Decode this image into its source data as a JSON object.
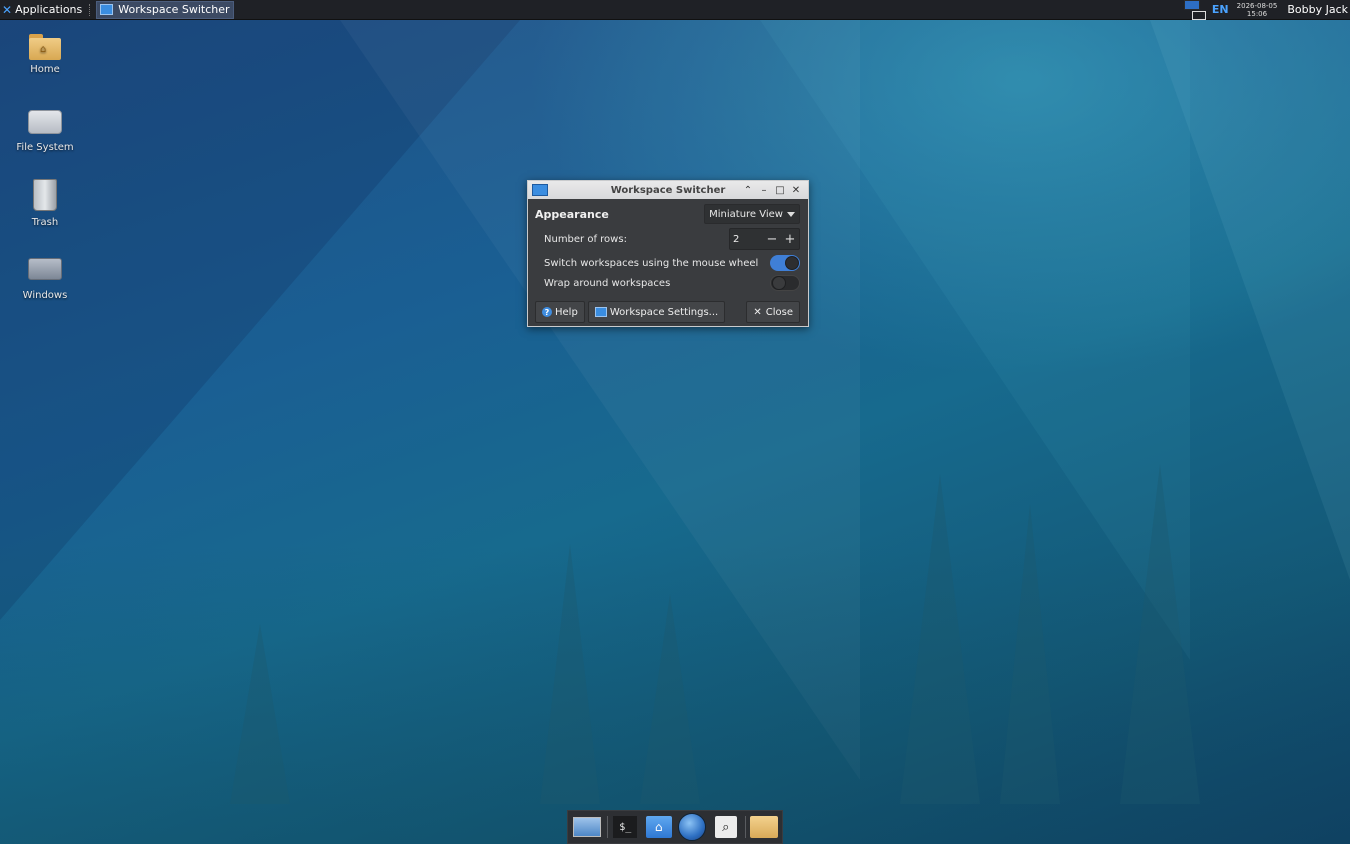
{
  "top_panel": {
    "apps_label": "Applications",
    "active_task": "Workspace Switcher",
    "lang": "EN",
    "date": "2026-08-05",
    "time": "15:06",
    "user": "Bobby Jack"
  },
  "desktop": {
    "icons": [
      {
        "label": "Home"
      },
      {
        "label": "File System"
      },
      {
        "label": "Trash"
      },
      {
        "label": "Windows"
      }
    ]
  },
  "dialog": {
    "title": "Workspace Switcher",
    "section": "Appearance",
    "view_mode": "Miniature View",
    "rows_label": "Number of rows:",
    "rows_value": "2",
    "wheel_label": "Switch workspaces using the mouse wheel",
    "wheel_on": true,
    "wrap_label": "Wrap around workspaces",
    "wrap_on": false,
    "help_label": "Help",
    "settings_label": "Workspace Settings...",
    "close_label": "Close"
  },
  "colors": {
    "accent": "#3f7fd6",
    "panel_bg": "#1f2126",
    "dialog_bg": "#3a3c3f"
  },
  "dock": {
    "items": [
      "desktop-icon",
      "terminal-icon",
      "home-folder-icon",
      "web-browser-icon",
      "search-icon",
      "file-manager-icon"
    ]
  }
}
